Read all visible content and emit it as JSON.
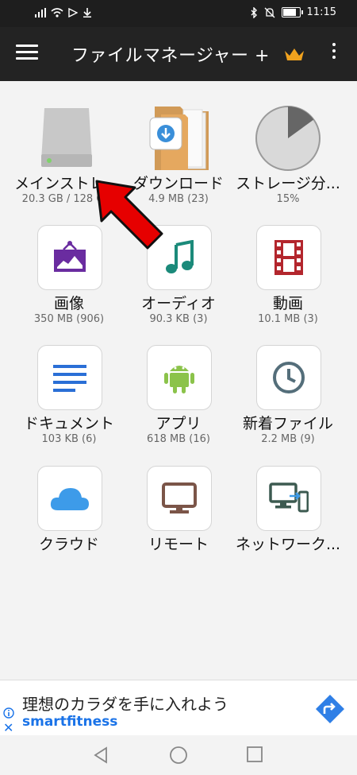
{
  "status": {
    "time": "11:15",
    "battery_level": 0.8
  },
  "app_bar": {
    "title": "ファイルマネージャー +"
  },
  "items": [
    {
      "label": "メインストレ...",
      "sub": "20.3 GB / 128 GB",
      "icon": "drive-icon"
    },
    {
      "label": "ダウンロード",
      "sub": "4.9 MB (23)",
      "icon": "download-folder-icon"
    },
    {
      "label": "ストレージ分...",
      "sub": "15%",
      "icon": "pie-chart-icon",
      "usage_fraction": 0.15
    },
    {
      "label": "画像",
      "sub": "350 MB (906)",
      "icon": "image-icon"
    },
    {
      "label": "オーディオ",
      "sub": "90.3 KB (3)",
      "icon": "music-note-icon"
    },
    {
      "label": "動画",
      "sub": "10.1 MB (3)",
      "icon": "film-icon"
    },
    {
      "label": "ドキュメント",
      "sub": "103 KB (6)",
      "icon": "document-icon"
    },
    {
      "label": "アプリ",
      "sub": "618 MB (16)",
      "icon": "android-icon"
    },
    {
      "label": "新着ファイル",
      "sub": "2.2 MB (9)",
      "icon": "clock-icon"
    },
    {
      "label": "クラウド",
      "sub": "",
      "icon": "cloud-icon"
    },
    {
      "label": "リモート",
      "sub": "",
      "icon": "monitor-icon"
    },
    {
      "label": "ネットワーク...",
      "sub": "",
      "icon": "network-devices-icon"
    }
  ],
  "ad": {
    "title": "理想のカラダを手に入れよう",
    "brand": "smartfitness"
  },
  "colors": {
    "accent_orange": "#f0a21e",
    "image_purple": "#6a2ca0",
    "audio_teal": "#1b8a7a",
    "video_red": "#b3262d",
    "doc_blue": "#2a6fd6",
    "android_green": "#8bc34a",
    "clock_slate": "#546e7a",
    "cloud_blue": "#3d9be9",
    "remote_brown": "#7b5548",
    "network_green": "#3c5a50",
    "arrow_red": "#e60000"
  }
}
